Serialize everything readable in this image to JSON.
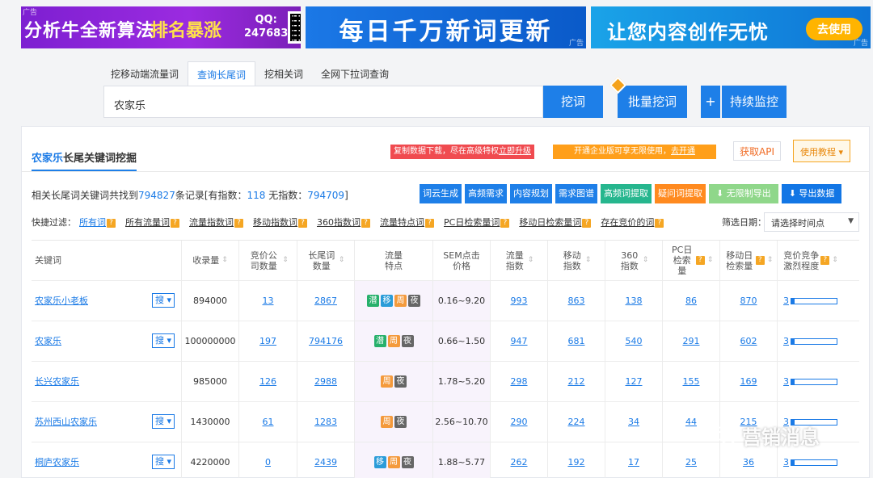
{
  "banners": {
    "b1": {
      "ad": "广告",
      "t1": "分析牛全新算法",
      "t2": "排名暴涨",
      "qq1": "QQ:",
      "qq2": "247683"
    },
    "b2": {
      "ad": "广告",
      "text": "每日千万新词更新"
    },
    "b3": {
      "ad": "广告",
      "text": "让您内容创作无忧",
      "button": "去使用"
    }
  },
  "search": {
    "tabs": [
      "挖移动端流量词",
      "查询长尾词",
      "挖相关词",
      "全网下拉词查询"
    ],
    "active_tab": 1,
    "value": "农家乐",
    "wa_button": "挖词",
    "batch_button": "批量挖词",
    "plus_button": "+",
    "monitor_button": "持续监控"
  },
  "panel": {
    "title_kw": "农家乐",
    "title_rest": "长尾关键词挖掘",
    "notice1_text": "复制数据下载，尽在高级特权",
    "notice1_link": "立即升级",
    "notice2_text": "开通企业版可享无限使用，",
    "notice2_link": "去开通",
    "api_button": "获取API",
    "tutorial_button": "使用教程 ▾",
    "summary": {
      "pre": "相关长尾词关键词共找到",
      "total": "794827",
      "mid1": "条记录[有指数：",
      "with_index": "118",
      "mid2": " 无指数：",
      "without_index": "794709",
      "post": "]"
    },
    "tools": [
      "词云生成",
      "高频需求",
      "内容规划",
      "需求图谱",
      "高频词提取",
      "疑问词提取",
      "⬇ 无限制导出",
      "⬇ 导出数据"
    ],
    "filter_label": "快捷过滤：",
    "filters": [
      "所有词",
      "所有流量词",
      "流量指数词",
      "移动指数词",
      "360指数词",
      "流量特点词",
      "PC日检索量词",
      "移动日检索量词",
      "存在竞价的词"
    ],
    "help_mark": "?",
    "date_label": "筛选日期：",
    "date_placeholder": "请选择时间点"
  },
  "table": {
    "headers": [
      "关键词",
      "收录量",
      "竞价公司数量",
      "长尾词数量",
      "流量特点",
      "SEM点击价格",
      "流量指数",
      "移动指数",
      "360指数",
      "PC日检索量",
      "移动日检索量",
      "竞价竞争激烈程度"
    ],
    "sou_label": "搜",
    "rows": [
      {
        "kw": "农家乐小老板",
        "sou": true,
        "shoulu": "894000",
        "jingjia": "13",
        "changwei": "2867",
        "tags": [
          "潜",
          "移",
          "周",
          "夜"
        ],
        "sem": "0.16~9.20",
        "liuliang": "993",
        "yidong": "863",
        "s360": "138",
        "pc": "86",
        "mobile": "870",
        "comp": "3",
        "comp_level": 0.08
      },
      {
        "kw": "农家乐",
        "sou": true,
        "shoulu": "100000000",
        "jingjia": "197",
        "changwei": "794176",
        "tags": [
          "潜",
          "周",
          "夜"
        ],
        "sem": "0.66~1.50",
        "liuliang": "947",
        "yidong": "681",
        "s360": "540",
        "pc": "291",
        "mobile": "602",
        "comp": "3",
        "comp_level": 0.08
      },
      {
        "kw": "长兴农家乐",
        "sou": false,
        "shoulu": "985000",
        "jingjia": "126",
        "changwei": "2988",
        "tags": [
          "周",
          "夜"
        ],
        "sem": "1.78~5.20",
        "liuliang": "298",
        "yidong": "212",
        "s360": "127",
        "pc": "155",
        "mobile": "169",
        "comp": "3",
        "comp_level": 0.08
      },
      {
        "kw": "苏州西山农家乐",
        "sou": true,
        "shoulu": "1430000",
        "jingjia": "61",
        "changwei": "1283",
        "tags": [
          "周",
          "夜"
        ],
        "sem": "2.56~10.70",
        "liuliang": "290",
        "yidong": "224",
        "s360": "34",
        "pc": "44",
        "mobile": "215",
        "comp": "3",
        "comp_level": 0.08
      },
      {
        "kw": "桐庐农家乐",
        "sou": true,
        "shoulu": "4220000",
        "jingjia": "0",
        "changwei": "2439",
        "tags": [
          "移",
          "周",
          "夜"
        ],
        "sem": "1.88~5.77",
        "liuliang": "262",
        "yidong": "192",
        "s360": "17",
        "pc": "25",
        "mobile": "36",
        "comp": "3",
        "comp_level": 0.08
      }
    ]
  },
  "watermark": "营销消息"
}
